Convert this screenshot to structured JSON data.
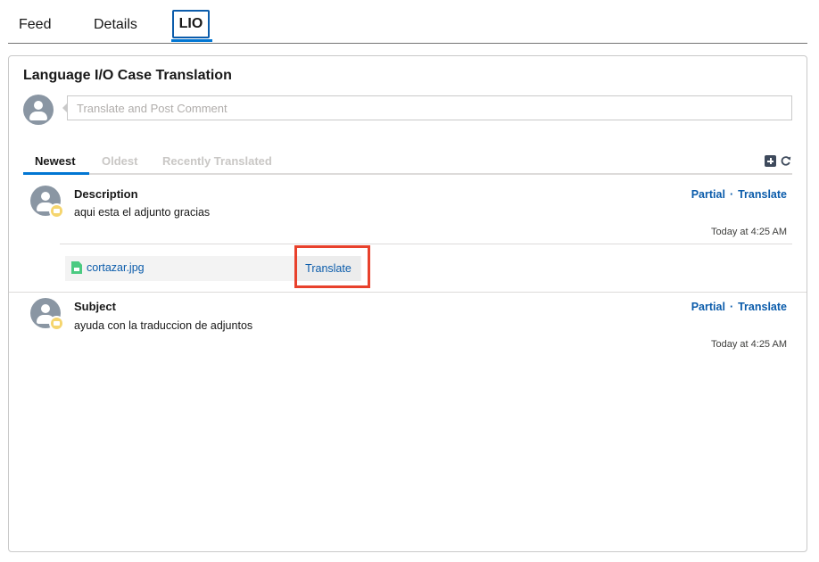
{
  "tabs": [
    {
      "label": "Feed",
      "active": false
    },
    {
      "label": "Details",
      "active": false
    },
    {
      "label": "LIO",
      "active": true
    }
  ],
  "card": {
    "title": "Language I/O Case Translation",
    "composer_placeholder": "Translate and Post Comment"
  },
  "sort_tabs": [
    {
      "label": "Newest",
      "active": true
    },
    {
      "label": "Oldest",
      "active": false
    },
    {
      "label": "Recently Translated",
      "active": false
    }
  ],
  "toolbar_icons": [
    "add-icon",
    "refresh-icon"
  ],
  "items": [
    {
      "label": "Description",
      "text": "aqui esta el adjunto gracias",
      "action_partial": "Partial",
      "action_separator": "·",
      "action_translate": "Translate",
      "time": "Today at 4:25 AM",
      "attachment": {
        "file_name": "cortazar.jpg",
        "translate_label": "Translate"
      }
    },
    {
      "label": "Subject",
      "text": "ayuda con la traduccion de adjuntos",
      "action_partial": "Partial",
      "action_separator": "·",
      "action_translate": "Translate",
      "time": "Today at 4:25 AM"
    }
  ],
  "colors": {
    "link": "#0b5cab",
    "accent": "#0176d3",
    "highlight": "#e8412c",
    "avatar": "#8a96a3",
    "badge": "#f5d56e",
    "file_icon": "#4bca81"
  }
}
